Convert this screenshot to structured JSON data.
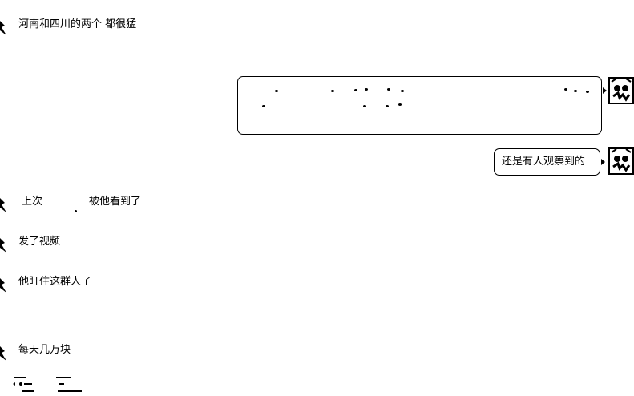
{
  "messages_left": [
    {
      "text": "河南和四川的两个 都很猛"
    },
    {
      "text_a": "上次",
      "text_b": "被他看到了"
    },
    {
      "text": "发了视频"
    },
    {
      "text": "他盯住这群人了"
    },
    {
      "text": "每天几万块"
    }
  ],
  "messages_right": [
    {
      "text": "还是有人观察到的"
    }
  ],
  "footer": {
    "left_frag": "",
    "right_frag": ""
  }
}
